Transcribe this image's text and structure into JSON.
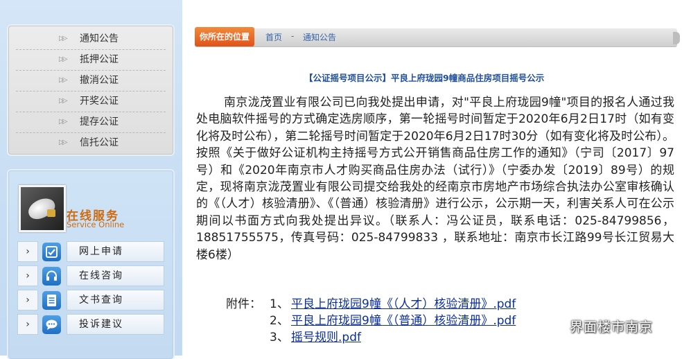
{
  "sidebar": {
    "menu": [
      {
        "label": "通知公告",
        "arrow": "▷▷"
      },
      {
        "label": "抵押公证",
        "arrow": "▷▷"
      },
      {
        "label": "撤消公证",
        "arrow": "▷▷"
      },
      {
        "label": "开奖公证",
        "arrow": "▷▷"
      },
      {
        "label": "提存公证",
        "arrow": "▷▷"
      },
      {
        "label": "信托公证",
        "arrow": "▷▷"
      }
    ],
    "service": {
      "title": "在线服务",
      "subtitle": "Service Online",
      "items": [
        {
          "label": "网上申请",
          "icon": "form-check-icon",
          "chevron": "›"
        },
        {
          "label": "在线咨询",
          "icon": "headset-icon",
          "chevron": "›"
        },
        {
          "label": "文书查询",
          "icon": "document-list-icon",
          "chevron": "›"
        },
        {
          "label": "投诉建议",
          "icon": "chat-bubble-icon",
          "chevron": "›"
        }
      ]
    }
  },
  "breadcrumb": {
    "location_label": "你所在的位置",
    "home": "首页",
    "separator": "-",
    "current": "通知公告"
  },
  "notice": {
    "title": "【公证摇号项目公示】平良上府珑园9幢商品住房项目摇号公示",
    "body": "南京泷茂置业有限公司已向我处提出申请，对\"平良上府珑园9幢\"项目的报名人通过我处电脑软件摇号的方式确定选房顺序，第一轮摇号时间暂定于2020年6月2日17时（如有变化将及时公布），第二轮摇号时间暂定于2020年6月2日17时30分（如有变化将及时公布）。按照《关于做好公证机构主持摇号方式公开销售商品住房工作的通知》（宁司〔2017〕97号）和《2020年南京市人才购买商品住房办法（试行）》（宁委办发〔2019〕89号）的规定，现将南京泷茂置业有限公司提交给我处的经南京市房地产市场综合执法办公室审核确认的《（人才）核验清册》、《（普通）核验清册》进行公示，公示期一天，利害关系人可在公示期间以书面方式向我处提出异议。（联系人：冯公证员，联系电话：025-84799856，18851755575，传真号码：025-84799833 ，联系地址：南京市长江路99号长江贸易大楼6楼）",
    "attachments_label": "附件：",
    "attachments": [
      {
        "num": "1、",
        "name": "平良上府珑园9幢《（人才）核验清册》.pdf"
      },
      {
        "num": "2、",
        "name": "平良上府珑园9幢《（普通）核验清册》.pdf"
      },
      {
        "num": "3、",
        "name": "摇号规则.pdf"
      }
    ]
  },
  "watermark": {
    "text": "界面楼市南京",
    "icon": "wechat-icon"
  },
  "colors": {
    "accent_orange": "#e0521a",
    "link_blue": "#0b2f9c",
    "title_blue": "#1f4f9c",
    "service_orange": "#cf6b10",
    "sidebar_bg": "#c7ddf3"
  }
}
